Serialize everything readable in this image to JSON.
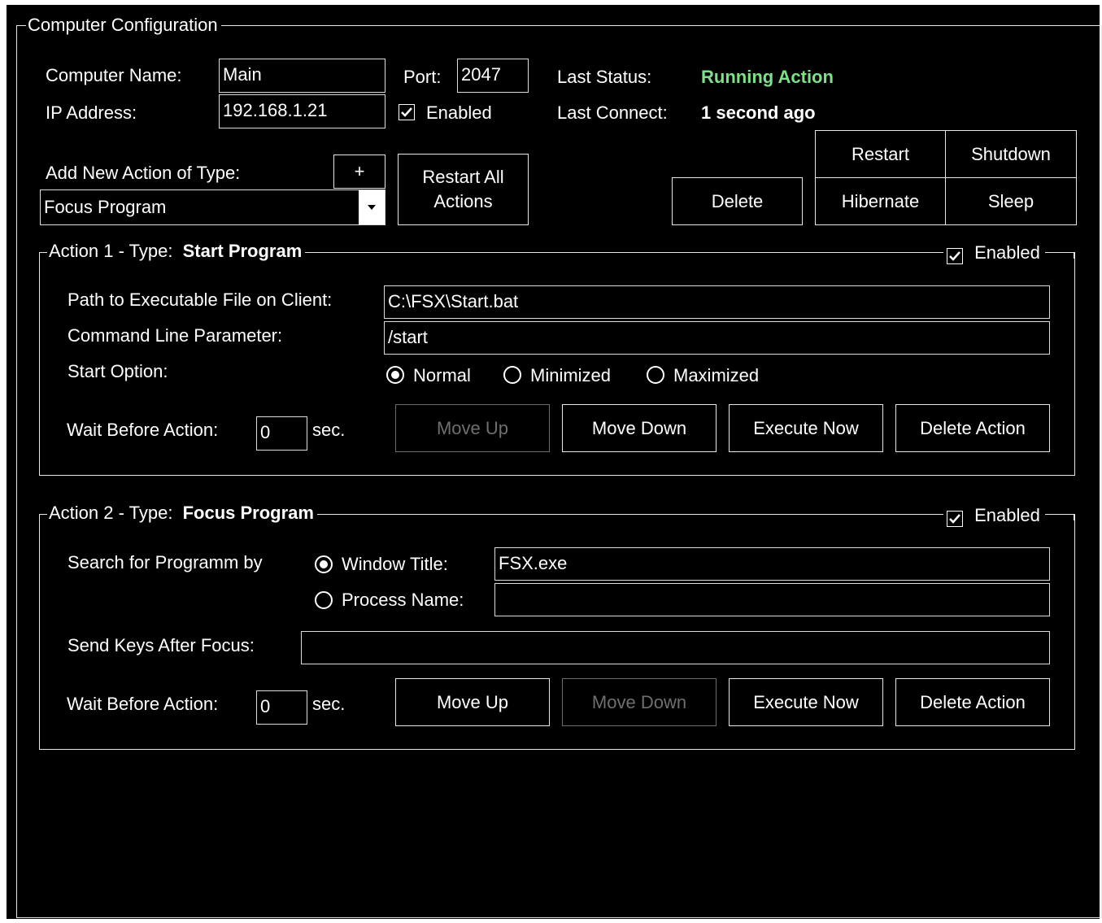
{
  "group_title": "Computer Configuration",
  "computer": {
    "name_label": "Computer Name:",
    "name_value": "Main",
    "ip_label": "IP Address:",
    "ip_value": "192.168.1.21",
    "port_label": "Port:",
    "port_value": "2047",
    "enabled_label": "Enabled",
    "enabled_checked": true,
    "last_status_label": "Last Status:",
    "last_status_value": "Running Action",
    "last_status_color": "#7fe08a",
    "last_connect_label": "Last Connect:",
    "last_connect_value": "1 second ago"
  },
  "add_action": {
    "label": "Add New Action of Type:",
    "add_button": "+",
    "selected_type": "Focus Program",
    "dropdown_icon": "chevron-down-icon",
    "restart_all": "Restart All Actions"
  },
  "power": {
    "delete": "Delete",
    "restart": "Restart",
    "shutdown": "Shutdown",
    "hibernate": "Hibernate",
    "sleep": "Sleep"
  },
  "actions": [
    {
      "title_prefix": "Action 1 - Type:",
      "type": "Start Program",
      "enabled_label": "Enabled",
      "enabled_checked": true,
      "path_label": "Path to Executable File on Client:",
      "path_value": "C:\\FSX\\Start.bat",
      "cmd_label": "Command Line Parameter:",
      "cmd_value": "/start",
      "start_option_label": "Start Option:",
      "start_options": [
        "Normal",
        "Minimized",
        "Maximized"
      ],
      "start_option_selected": "Normal",
      "wait_label": "Wait Before Action:",
      "wait_value": "0",
      "wait_unit": "sec.",
      "move_up": "Move Up",
      "move_up_enabled": false,
      "move_down": "Move Down",
      "move_down_enabled": true,
      "execute_now": "Execute Now",
      "delete_action": "Delete Action"
    },
    {
      "title_prefix": "Action 2 - Type:",
      "type": "Focus Program",
      "enabled_label": "Enabled",
      "enabled_checked": true,
      "search_label": "Search for Programm by",
      "window_title_label": "Window Title:",
      "window_title_value": "FSX.exe",
      "process_name_label": "Process Name:",
      "process_name_value": "",
      "search_selected": "Window Title",
      "send_keys_label": "Send Keys After Focus:",
      "send_keys_value": "",
      "wait_label": "Wait Before Action:",
      "wait_value": "0",
      "wait_unit": "sec.",
      "move_up": "Move Up",
      "move_up_enabled": true,
      "move_down": "Move Down",
      "move_down_enabled": false,
      "execute_now": "Execute Now",
      "delete_action": "Delete Action"
    }
  ]
}
